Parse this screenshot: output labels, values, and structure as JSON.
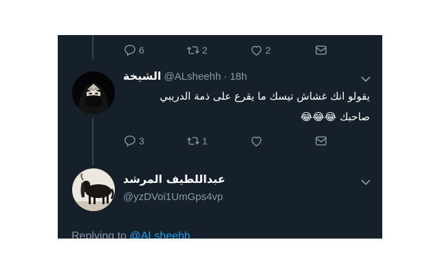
{
  "tweet_top": {
    "actions": {
      "reply_count": "6",
      "retweet_count": "2",
      "like_count": "2"
    }
  },
  "tweet_main": {
    "display_name": "الشيخة",
    "handle": "@ALsheehh",
    "separator": "·",
    "time": "18h",
    "text_line1": "يقولو انك غشاش تيسك ما يقرع على ذمة الدريبي",
    "text_line2": "صاحبك",
    "emoji": "😂😂😂",
    "actions": {
      "reply_count": "3",
      "retweet_count": "1",
      "like_count": ""
    }
  },
  "reply_account": {
    "display_name": "عبداللطيف المرشد",
    "handle": "@yzDVoi1UmGps4vp"
  },
  "replying_to": {
    "label": "Replying to",
    "mention": "@ALsheehh"
  },
  "icons": [
    "reply-icon",
    "retweet-icon",
    "like-icon",
    "dm-icon",
    "chevron-down-icon"
  ],
  "colors": {
    "background": "#15202b",
    "text": "#ffffff",
    "secondary": "#8899a6",
    "accent": "#1da1f2"
  }
}
